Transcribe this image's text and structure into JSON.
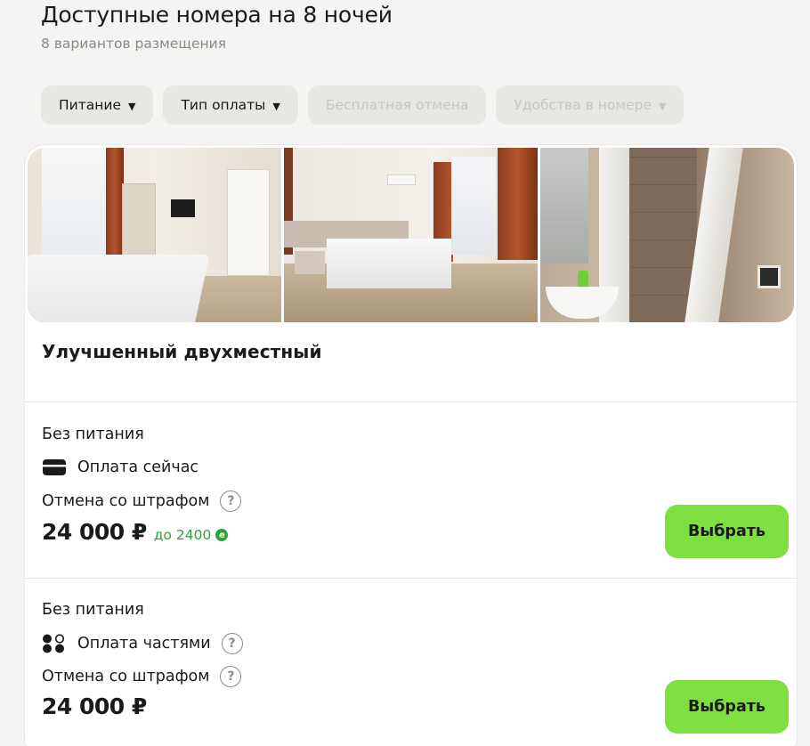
{
  "header": {
    "title": "Доступные номера на 8 ночей",
    "subtitle": "8 вариантов размещения"
  },
  "filters": [
    {
      "label": "Питание",
      "enabled": true
    },
    {
      "label": "Тип оплаты",
      "enabled": true
    },
    {
      "label": "Бесплатная отмена",
      "enabled": false
    },
    {
      "label": "Удобства в номере",
      "enabled": false
    }
  ],
  "icons": {
    "caret": "caret-down-icon",
    "card": "credit-card-icon",
    "installments": "installments-icon",
    "help": "help-circle-icon",
    "cashback": "cashback-icon"
  },
  "colors": {
    "accent": "#7de040",
    "cashback": "#2fa236",
    "page_bg": "#f5f4f2"
  },
  "room": {
    "photos": [
      "room-photo-1",
      "room-photo-2",
      "room-photo-3"
    ],
    "title": "Улучшенный двухместный",
    "rates": [
      {
        "meal": "Без питания",
        "payment": "Оплата сейчас",
        "cancellation": "Отмена со штрафом",
        "price": "24 000 ₽",
        "cashback": "до 2400",
        "button": "Выбрать"
      },
      {
        "meal": "Без питания",
        "payment": "Оплата частями",
        "cancellation": "Отмена со штрафом",
        "price": "24 000 ₽",
        "button": "Выбрать"
      }
    ]
  },
  "help_glyph": "?",
  "cashback_glyph": "е"
}
